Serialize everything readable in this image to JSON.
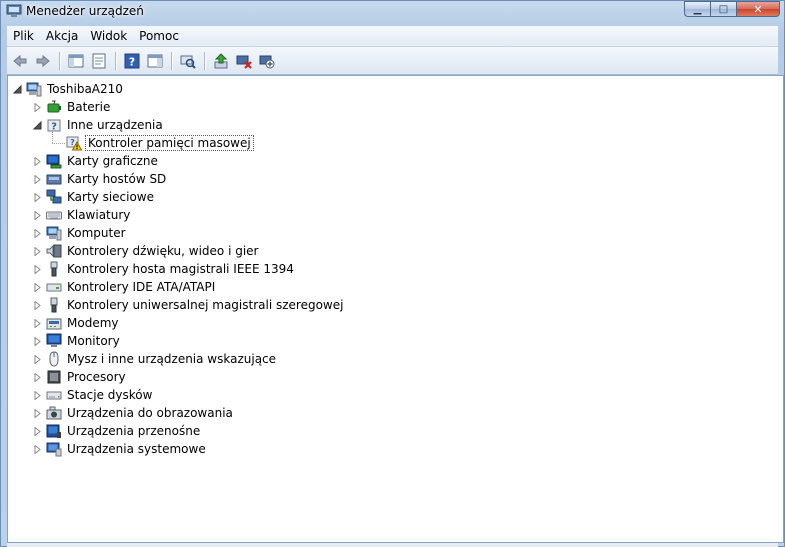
{
  "window": {
    "title": "Menedżer urządzeń",
    "min_label": "▁",
    "max_label": "□",
    "close_label": "✕"
  },
  "menu": {
    "items": [
      "Plik",
      "Akcja",
      "Widok",
      "Pomoc"
    ]
  },
  "toolbar": {
    "buttons": [
      {
        "name": "back",
        "icon": "arrow-left-icon"
      },
      {
        "name": "forward",
        "icon": "arrow-right-icon"
      },
      {
        "name": "show-hide-console-tree",
        "icon": "console-tree-icon"
      },
      {
        "name": "properties",
        "icon": "properties-icon"
      },
      {
        "name": "help",
        "icon": "help-icon"
      },
      {
        "name": "show-action-pane",
        "icon": "action-pane-icon"
      },
      {
        "name": "scan-hardware",
        "icon": "scan-hardware-icon"
      },
      {
        "name": "update-driver",
        "icon": "update-driver-icon"
      },
      {
        "name": "uninstall",
        "icon": "uninstall-icon"
      },
      {
        "name": "disable",
        "icon": "disable-icon"
      }
    ]
  },
  "tree": {
    "root": {
      "label": "ToshibaA210",
      "icon": "computer-icon",
      "expanded": true
    },
    "nodes": [
      {
        "label": "Baterie",
        "icon": "battery-icon",
        "expanded": false
      },
      {
        "label": "Inne urządzenia",
        "icon": "unknown-device-icon",
        "expanded": true,
        "children": [
          {
            "label": "Kontroler pamięci masowej",
            "icon": "warning-device-icon",
            "selected": true
          }
        ]
      },
      {
        "label": "Karty graficzne",
        "icon": "display-adapter-icon",
        "expanded": false
      },
      {
        "label": "Karty hostów SD",
        "icon": "sd-host-icon",
        "expanded": false
      },
      {
        "label": "Karty sieciowe",
        "icon": "network-adapter-icon",
        "expanded": false
      },
      {
        "label": "Klawiatury",
        "icon": "keyboard-icon",
        "expanded": false
      },
      {
        "label": "Komputer",
        "icon": "computer-icon",
        "expanded": false
      },
      {
        "label": "Kontrolery dźwięku, wideo i gier",
        "icon": "sound-icon",
        "expanded": false
      },
      {
        "label": "Kontrolery hosta magistrali IEEE 1394",
        "icon": "ieee1394-icon",
        "expanded": false
      },
      {
        "label": "Kontrolery IDE ATA/ATAPI",
        "icon": "ide-controller-icon",
        "expanded": false
      },
      {
        "label": "Kontrolery uniwersalnej magistrali szeregowej",
        "icon": "usb-icon",
        "expanded": false
      },
      {
        "label": "Modemy",
        "icon": "modem-icon",
        "expanded": false
      },
      {
        "label": "Monitory",
        "icon": "monitor-icon",
        "expanded": false
      },
      {
        "label": "Mysz i inne urządzenia wskazujące",
        "icon": "mouse-icon",
        "expanded": false
      },
      {
        "label": "Procesory",
        "icon": "processor-icon",
        "expanded": false
      },
      {
        "label": "Stacje dysków",
        "icon": "disk-drive-icon",
        "expanded": false
      },
      {
        "label": "Urządzenia do obrazowania",
        "icon": "imaging-device-icon",
        "expanded": false
      },
      {
        "label": "Urządzenia przenośne",
        "icon": "portable-device-icon",
        "expanded": false
      },
      {
        "label": "Urządzenia systemowe",
        "icon": "system-device-icon",
        "expanded": false
      }
    ]
  }
}
